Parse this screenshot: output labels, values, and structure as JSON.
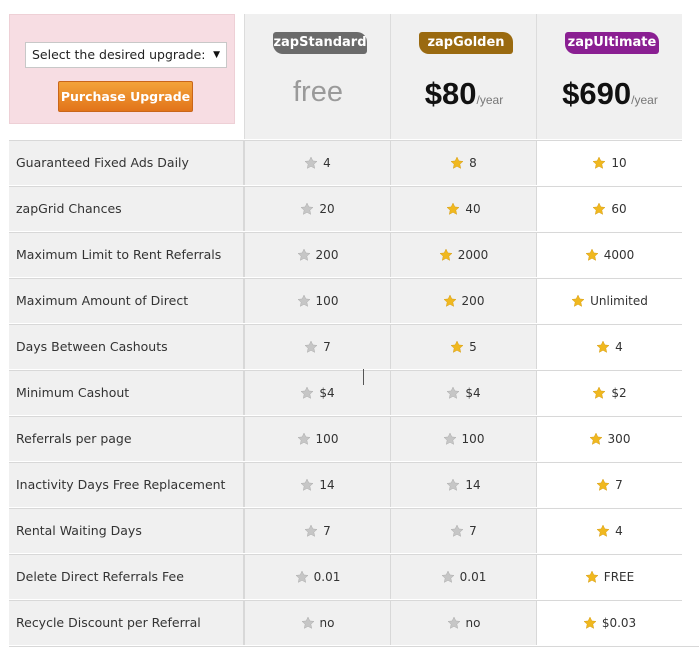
{
  "upgrade": {
    "select_value": "Select the desired upgrade:",
    "purchase_label": "Purchase Upgrade"
  },
  "plans": [
    {
      "name": "zapStandard",
      "badge_color": "#6b6b6b",
      "price": "free",
      "unit": "",
      "star_color": "#c8c8c8"
    },
    {
      "name": "zapGolden",
      "badge_color": "#9a6a10",
      "price": "$80",
      "unit": "/year",
      "star_color": "#e9b62a"
    },
    {
      "name": "zapUltimate",
      "badge_color": "#8a1f92",
      "price": "$690",
      "unit": "/year",
      "star_color": "#f3bd1b"
    }
  ],
  "features": [
    {
      "label": "Guaranteed Fixed Ads Daily",
      "values": [
        "4",
        "8",
        "10"
      ],
      "stars": [
        "grey",
        "gold",
        "gold"
      ]
    },
    {
      "label": "zapGrid Chances",
      "values": [
        "20",
        "40",
        "60"
      ],
      "stars": [
        "grey",
        "gold",
        "gold"
      ]
    },
    {
      "label": "Maximum Limit to Rent Referrals",
      "values": [
        "200",
        "2000",
        "4000"
      ],
      "stars": [
        "grey",
        "gold",
        "gold"
      ]
    },
    {
      "label": "Maximum Amount of Direct Referrals",
      "values": [
        "100",
        "200",
        "Unlimited"
      ],
      "stars": [
        "grey",
        "gold",
        "gold"
      ]
    },
    {
      "label": "Days Between Cashouts",
      "values": [
        "7",
        "5",
        "4"
      ],
      "stars": [
        "grey",
        "gold",
        "gold"
      ]
    },
    {
      "label": "Minimum Cashout",
      "values": [
        "$4",
        "$4",
        "$2"
      ],
      "stars": [
        "grey",
        "grey",
        "gold"
      ]
    },
    {
      "label": "Referrals per page",
      "values": [
        "100",
        "100",
        "300"
      ],
      "stars": [
        "grey",
        "grey",
        "gold"
      ]
    },
    {
      "label": "Inactivity Days Free Replacement",
      "values": [
        "14",
        "14",
        "7"
      ],
      "stars": [
        "grey",
        "grey",
        "gold"
      ]
    },
    {
      "label": "Rental Waiting Days",
      "values": [
        "7",
        "7",
        "4"
      ],
      "stars": [
        "grey",
        "grey",
        "gold"
      ]
    },
    {
      "label": "Delete Direct Referrals Fee",
      "values": [
        "0.01",
        "0.01",
        "FREE"
      ],
      "stars": [
        "grey",
        "grey",
        "gold"
      ]
    },
    {
      "label": "Recycle Discount per Referral",
      "values": [
        "no",
        "no",
        "$0.03"
      ],
      "stars": [
        "grey",
        "grey",
        "gold"
      ]
    }
  ],
  "colors": {
    "grey_star": "#c6c6c6",
    "gold_star": "#f0b81f"
  }
}
